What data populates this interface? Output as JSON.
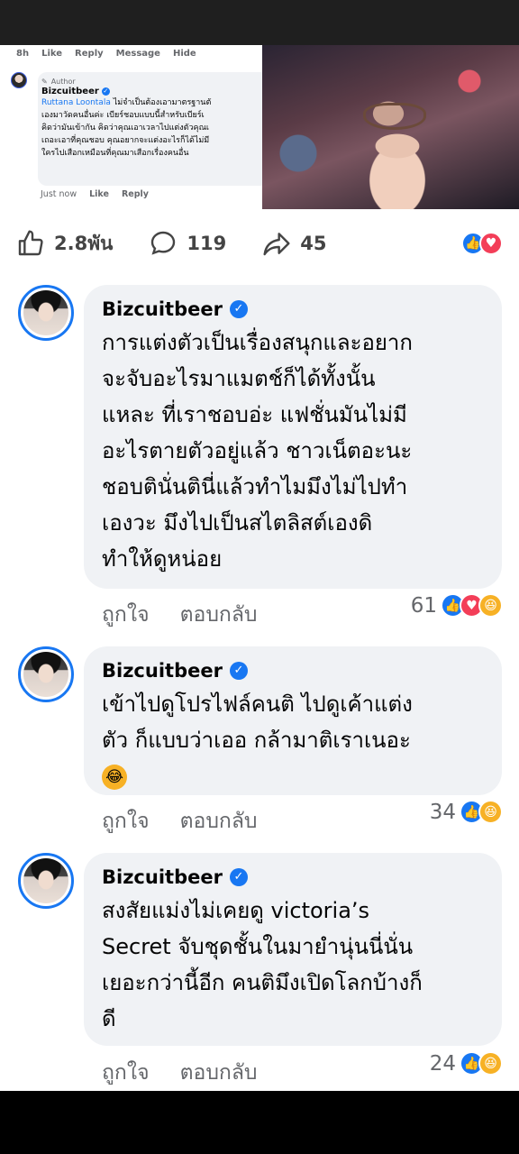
{
  "inner": {
    "meta": [
      "8h",
      "Like",
      "Reply",
      "Message",
      "Hide"
    ],
    "author_tag": "Author",
    "name": "Bizcuitbeer",
    "mention": "Ruttana Loontala",
    "lines": [
      " ไม่จำเป็นต้องเอามาตรฐานตั",
      "เองมาวัดคนอื่นค่ะ เบียร์ชอบแบบนี้สำหรับเบียร์เ",
      "คิดว่ามันเข้ากัน คิดว่าคุณเอาเวลาไปแต่งตัวคุณเ",
      "เถอะเอาที่คุณชอบ คุณอยากจะแต่งอะไรก็ได้ไม่มี",
      "ใครไปเสือกเหมือนที่คุณมาเสือกเรื่องคนอื่น"
    ],
    "footer_time": "Just now",
    "footer_like": "Like",
    "footer_reply": "Reply"
  },
  "stats": {
    "likes": "2.8พัน",
    "comments": "119",
    "shares": "45"
  },
  "comments": [
    {
      "author": "Bizcuitbeer",
      "lines": [
        "การแต่งตัวเป็นเรื่องสนุกและอยาก",
        "จะจับอะไรมาแมตช์ก็ได้ทั้งนั้น",
        "แหละ ที่เราชอบอ่ะ แฟชั่นมันไม่มี",
        "อะไรตายตัวอยู่แล้ว ชาวเน็ตอะนะ",
        "ชอบตินั่นตินี่แล้วทำไมมึงไม่ไปทำ",
        "เองวะ มึงไปเป็นสไตลิสต์เองดิ",
        "ทำให้ดูหน่อย"
      ],
      "like_label": "ถูกใจ",
      "reply_label": "ตอบกลับ",
      "reaction_count": "61",
      "reactions": [
        "like",
        "love",
        "haha"
      ]
    },
    {
      "author": "Bizcuitbeer",
      "lines": [
        "เข้าไปดูโปรไฟล์คนติ ไปดูเค้าแต่ง",
        "ตัว ก็แบบว่าเออ กล้ามาติเราเนอะ"
      ],
      "emoji": "😂",
      "like_label": "ถูกใจ",
      "reply_label": "ตอบกลับ",
      "reaction_count": "34",
      "reactions": [
        "like",
        "haha"
      ]
    },
    {
      "author": "Bizcuitbeer",
      "lines": [
        "สงสัยแม่งไม่เคยดู victoria’s",
        "Secret จับชุดชั้นในมายำนุ่นนี่นั่น",
        "เยอะกว่านี้อีก คนติมึงเปิดโลกบ้างก็",
        "ดี"
      ],
      "like_label": "ถูกใจ",
      "reply_label": "ตอบกลับ",
      "reaction_count": "24",
      "reactions": [
        "like",
        "haha"
      ]
    }
  ]
}
